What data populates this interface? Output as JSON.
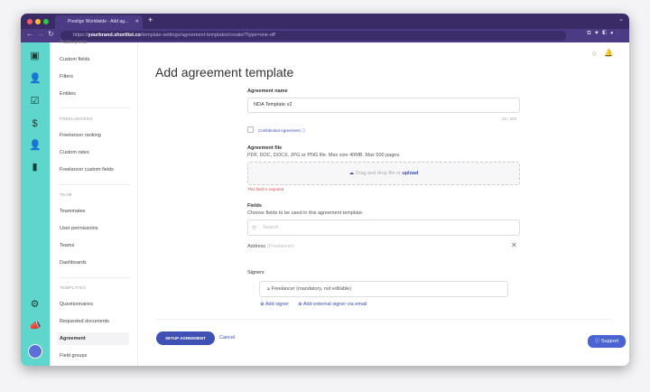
{
  "browser": {
    "tab_title": "Prestige Worldwide - Add ag...",
    "url_prefix": "https://",
    "url_domain": "yourbrand.shortlist.co",
    "url_path": "/template-settings/agreement-templates/create/?type=one-off"
  },
  "sidebar": {
    "partial_top": "Public portal",
    "items_a": [
      "Custom fields",
      "Filters",
      "Entities"
    ],
    "section_freelancers": "FREELANCERS",
    "items_b": [
      "Freelancer ranking",
      "Custom rates",
      "Freelancer custom fields"
    ],
    "section_team": "TEAM",
    "items_c": [
      "Teammates",
      "User permissions",
      "Teams",
      "Dashboards"
    ],
    "section_templates": "TEMPLATES",
    "items_d": [
      "Questionnaires",
      "Requested documents",
      "Agreement",
      "Field groups"
    ],
    "active": "Agreement"
  },
  "page": {
    "title": "Add agreement template"
  },
  "form": {
    "name_label": "Agreement name",
    "name_value": "NDA Template v2",
    "name_counter": "15 / 200",
    "confidential_label": "Confidential Agreement",
    "file_label": "Agreement file",
    "file_hint": "PDF, DOC, DOCX, JPG or PNG file. Max size 40MB. Max 500 pages.",
    "drop_text": "Drag and drop file or ",
    "drop_link": "upload",
    "file_error": "This field is required",
    "fields_label": "Fields",
    "fields_hint": "Choose fields to be used in this agreement template.",
    "search_placeholder": "Search",
    "field_item": "Address",
    "field_item_sub": "(Freelancer)",
    "signers_label": "Signers",
    "signer": "Freelancer (mandatory, not editable)",
    "add_signer": "Add signer",
    "add_external": "Add external signer via email"
  },
  "actions": {
    "submit": "SETUP AGREEMENT",
    "cancel": "Cancel",
    "support": "Support"
  },
  "colors": {
    "rail": "#5fd6cb",
    "primary": "#3f51b5",
    "browser": "#3a2a66",
    "error": "#e04848"
  }
}
